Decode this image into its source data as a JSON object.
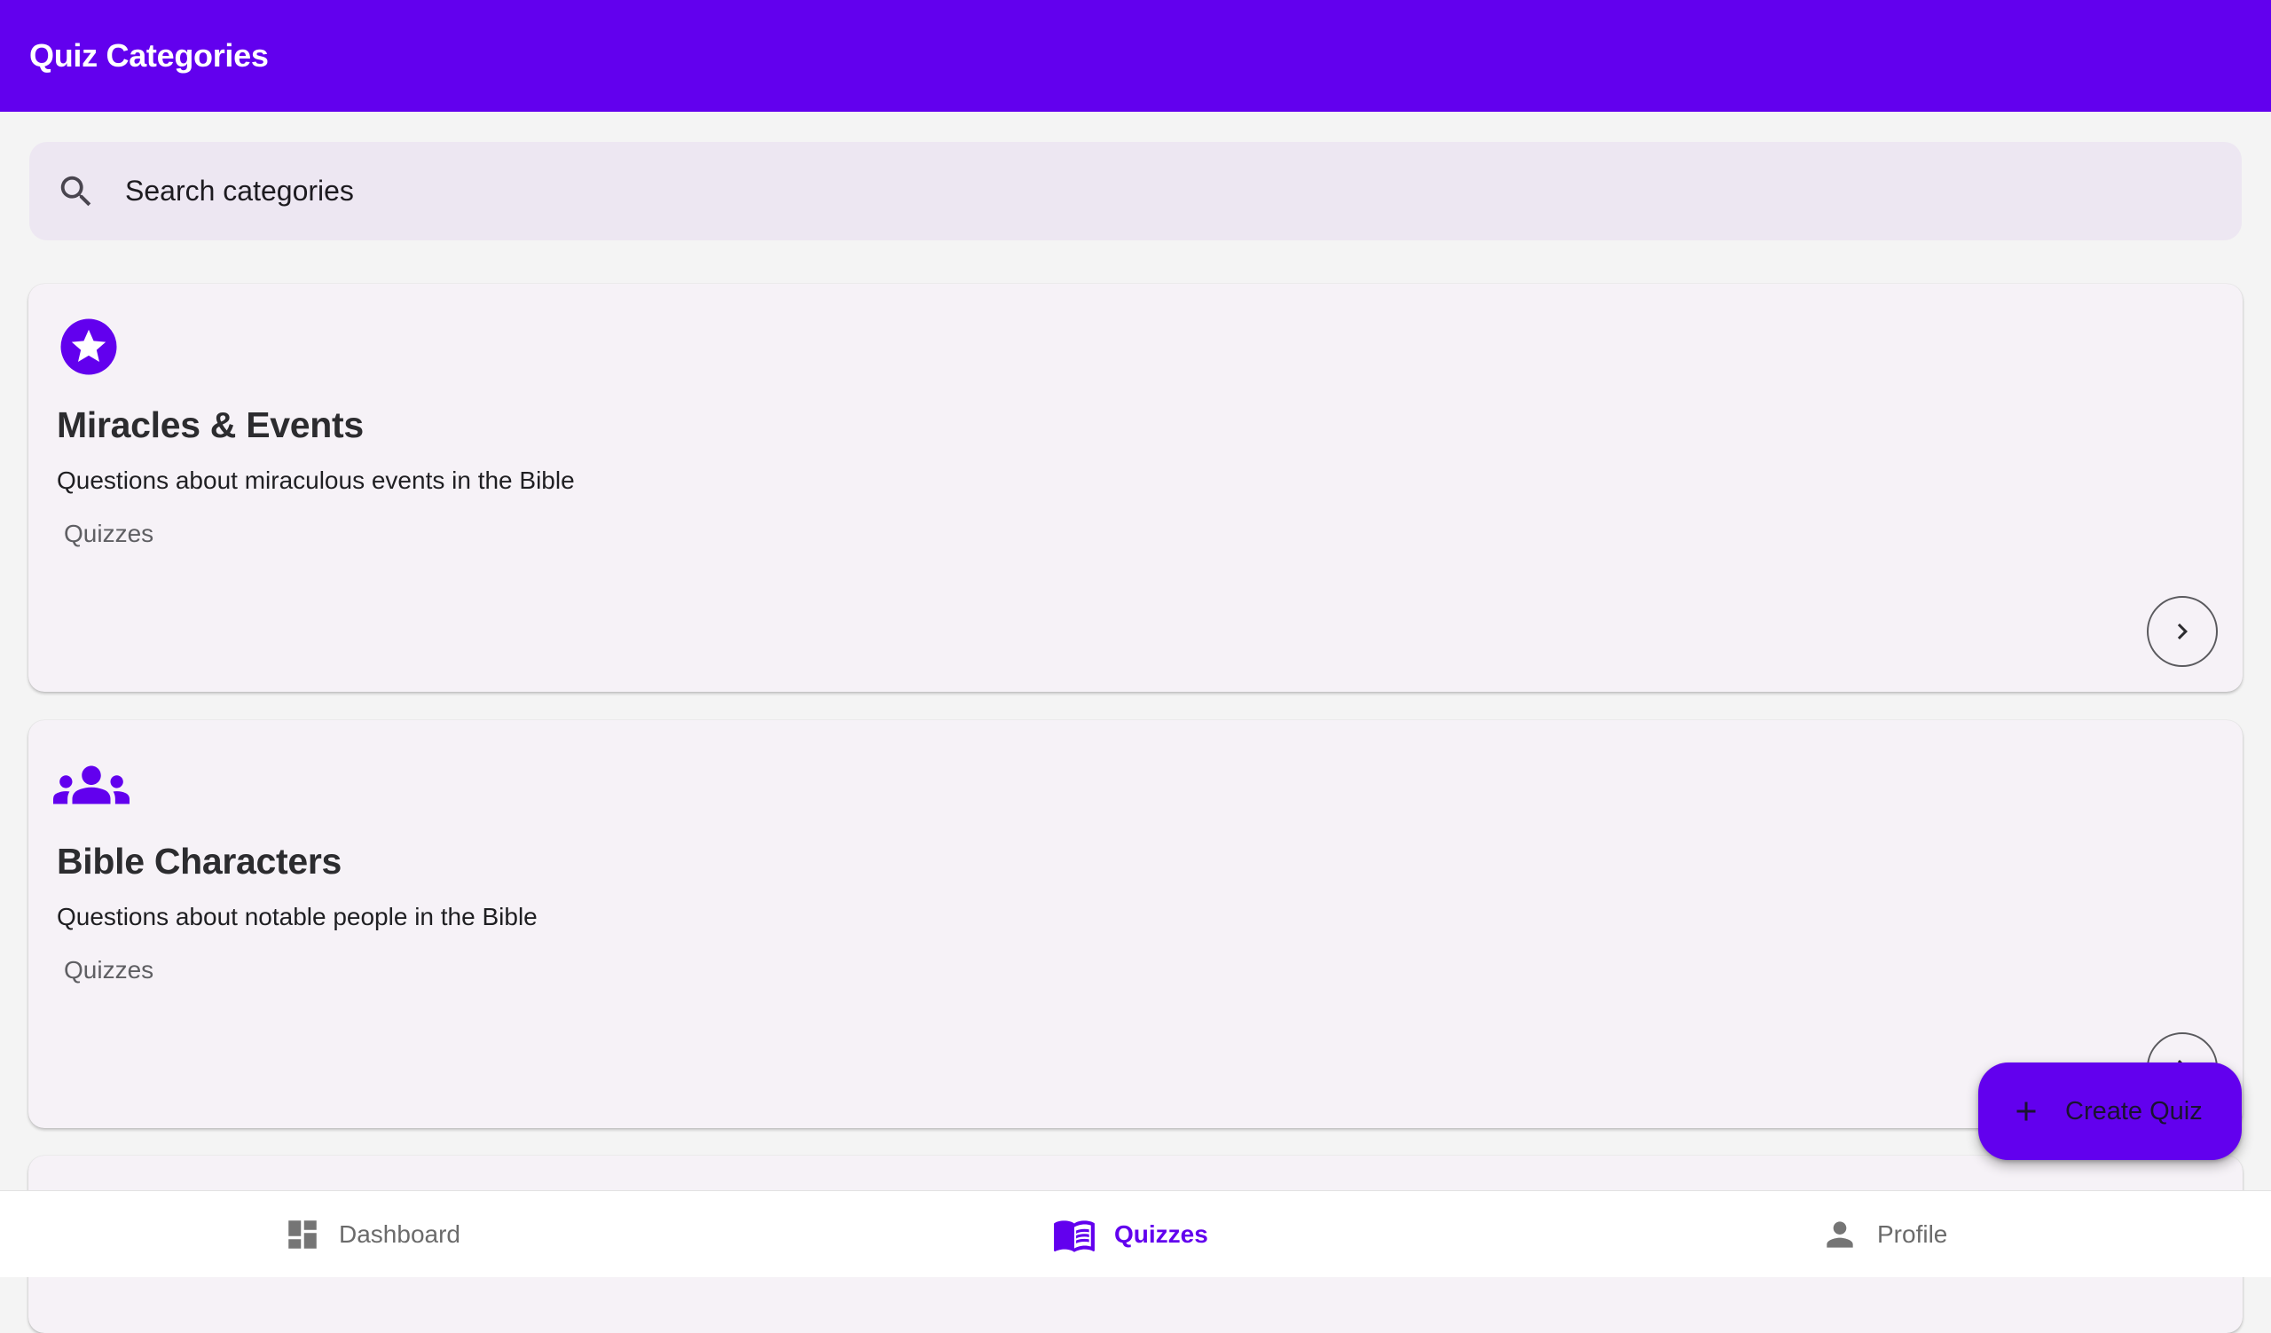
{
  "app_bar": {
    "title": "Quiz Categories",
    "background_color": "#6200ee"
  },
  "search": {
    "icon": "search-icon",
    "placeholder": "Search categories",
    "value": ""
  },
  "categories": [
    {
      "icon": "star-circle-icon",
      "title": "Miracles & Events",
      "description": "Questions about miraculous events in the Bible",
      "meta": "Quizzes",
      "action_icon": "chevron-right-icon"
    },
    {
      "icon": "groups-icon",
      "title": "Bible Characters",
      "description": "Questions about notable people in the Bible",
      "meta": "Quizzes",
      "action_icon": "chevron-right-icon"
    }
  ],
  "fab": {
    "icon": "plus-icon",
    "label": "Create Quiz"
  },
  "bottom_nav": {
    "items": [
      {
        "label": "Dashboard",
        "icon": "dashboard-icon",
        "active": false
      },
      {
        "label": "Quizzes",
        "icon": "menu-book-icon",
        "active": true
      },
      {
        "label": "Profile",
        "icon": "person-icon",
        "active": false
      }
    ]
  },
  "colors": {
    "primary": "#6200ee",
    "card_background": "#f6f2f7",
    "search_background": "#ede7f2",
    "nav_inactive": "#6b6b6b"
  }
}
